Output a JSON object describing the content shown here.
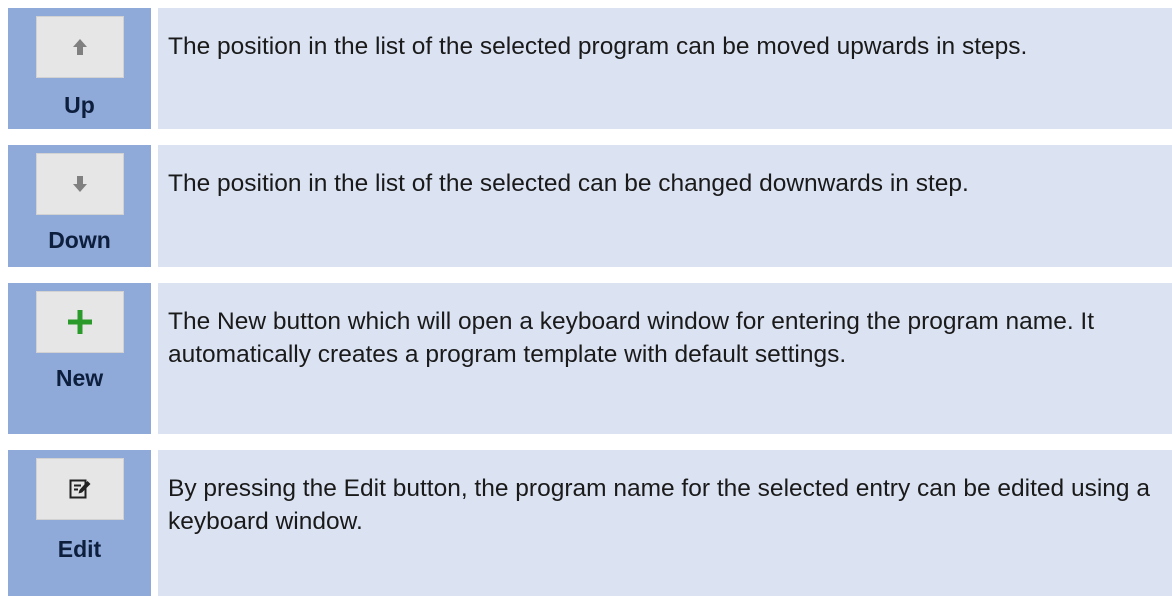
{
  "rows": [
    {
      "button_label": "Up",
      "icon": "arrow-up-icon",
      "description": "The position in the list of the selected program can be moved upwards in steps."
    },
    {
      "button_label": "Down",
      "icon": "arrow-down-icon",
      "description": "The position in the list of the selected can be changed downwards in step."
    },
    {
      "button_label": "New",
      "icon": "plus-icon",
      "description": "The New button which will open a keyboard window for entering the program name. It automatically creates a program template with default settings."
    },
    {
      "button_label": "Edit",
      "icon": "edit-icon",
      "description": "By pressing the Edit button, the program name for the selected entry can be edited using a keyboard window."
    }
  ],
  "colors": {
    "icon_column": "#8fa9d9",
    "description_column": "#dbe3f3",
    "button_face": "#e6e6e6",
    "plus_icon": "#2a9a2a",
    "arrow_icon": "#808080",
    "label_text": "#0d1f3d"
  }
}
